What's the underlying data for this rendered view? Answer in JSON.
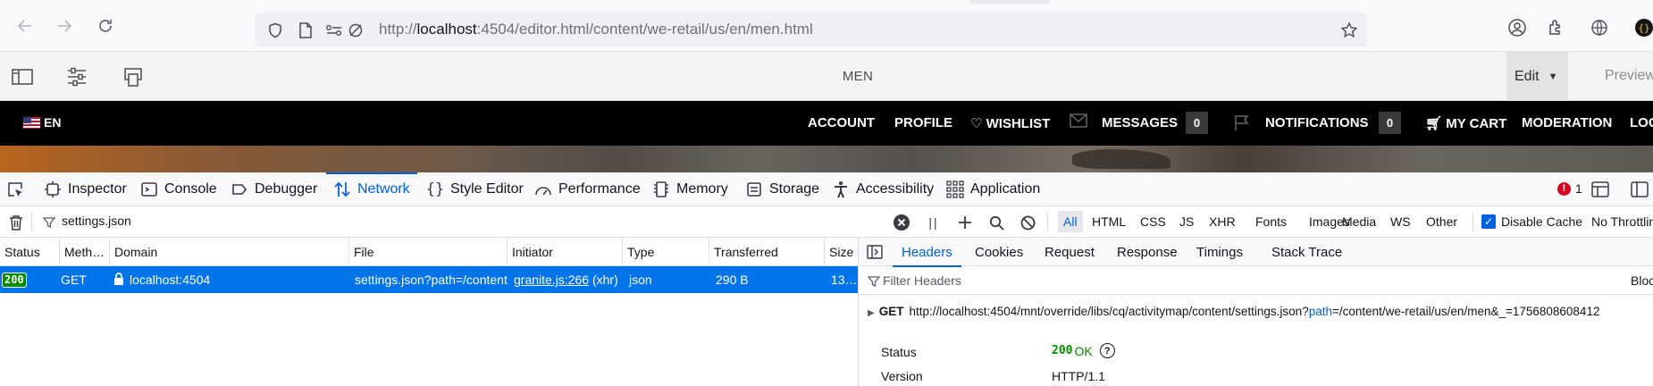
{
  "browser": {
    "url_prefix": "http://",
    "url_host": "localhost",
    "url_rest": ":4504/editor.html/content/we-retail/us/en/men.html"
  },
  "aem": {
    "page_title": "MEN",
    "mode": "Edit",
    "preview": "Preview"
  },
  "site_nav": {
    "lang": "EN",
    "items": {
      "account": "ACCOUNT",
      "profile": "PROFILE",
      "wishlist": "WISHLIST",
      "messages": "MESSAGES",
      "messages_count": "0",
      "notifications": "NOTIFICATIONS",
      "notifications_count": "0",
      "cart": "MY CART",
      "moderation": "MODERATION",
      "logout": "LOG"
    }
  },
  "devtools": {
    "tabs": {
      "inspector": "Inspector",
      "console": "Console",
      "debugger": "Debugger",
      "network": "Network",
      "style_editor": "Style Editor",
      "performance": "Performance",
      "memory": "Memory",
      "storage": "Storage",
      "accessibility": "Accessibility",
      "application": "Application"
    },
    "error_count": "1"
  },
  "network": {
    "filter_value": "settings.json",
    "types": {
      "all": "All",
      "html": "HTML",
      "css": "CSS",
      "js": "JS",
      "xhr": "XHR",
      "fonts": "Fonts",
      "images": "Images",
      "media": "Media",
      "ws": "WS",
      "other": "Other"
    },
    "disable_cache": "Disable Cache",
    "throttling": "No Throttling",
    "columns": {
      "status": "Status",
      "method": "Meth…",
      "domain": "Domain",
      "file": "File",
      "initiator": "Initiator",
      "type": "Type",
      "transferred": "Transferred",
      "size": "Size"
    },
    "row": {
      "status": "200",
      "method": "GET",
      "domain": "localhost:4504",
      "file": "settings.json?path=/content",
      "initiator_link": "granite.js:266",
      "initiator_suffix": "(xhr)",
      "type": "json",
      "transferred": "290 B",
      "size": "13…"
    }
  },
  "details": {
    "tabs": {
      "headers": "Headers",
      "cookies": "Cookies",
      "request": "Request",
      "response": "Response",
      "timings": "Timings",
      "stack_trace": "Stack Trace"
    },
    "filter_placeholder": "Filter Headers",
    "block": "Bloc",
    "request_method": "GET",
    "request_url_base": "http://localhost:4504/mnt/override/libs/cq/activitymap/content/settings.json?",
    "request_url_param": "path",
    "request_url_rest": "=/content/we-retail/us/en/men&_=1756808608412",
    "status_label": "Status",
    "status_code": "200",
    "status_text": "OK",
    "version_label": "Version",
    "version_value": "HTTP/1.1"
  }
}
